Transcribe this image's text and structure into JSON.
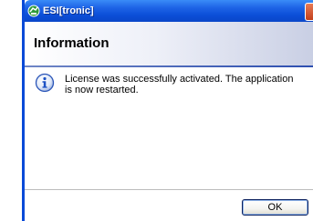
{
  "window": {
    "title": "ESI[tronic]",
    "icon": "esitronic-app-icon",
    "close_icon": "close-icon"
  },
  "dialog": {
    "heading": "Information",
    "icon": "info-icon",
    "message": "License was successfully activated. The application is now restarted.",
    "ok_label": "OK"
  },
  "colors": {
    "titlebar": "#0b4ed8",
    "title_text": "#ffffff",
    "header_band_end": "#c9cfe4",
    "info_icon": "#1d52c4"
  }
}
